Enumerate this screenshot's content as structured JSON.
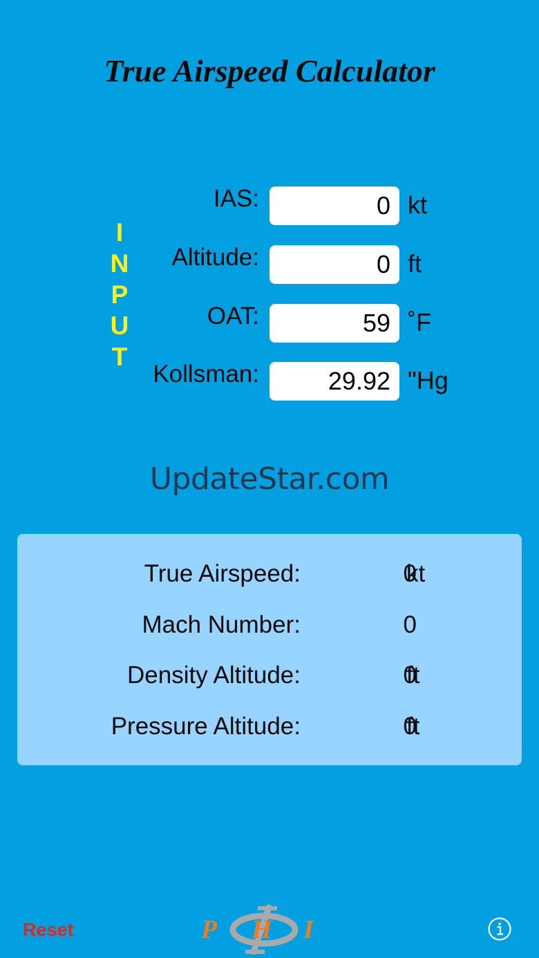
{
  "app": {
    "title": "True Airspeed Calculator"
  },
  "input_section": {
    "vertical_label": [
      "I",
      "N",
      "P",
      "U",
      "T"
    ],
    "fields": [
      {
        "label": "IAS:",
        "value": "0",
        "unit": "kt"
      },
      {
        "label": "Altitude:",
        "value": "0",
        "unit": "ft"
      },
      {
        "label": "OAT:",
        "value": "59",
        "unit": "˚F"
      },
      {
        "label": "Kollsman:",
        "value": "29.92",
        "unit": "\"Hg"
      }
    ]
  },
  "watermark": "UpdateStar.com",
  "results": [
    {
      "label": "True Airspeed:",
      "value": "0",
      "unit": "kt"
    },
    {
      "label": "Mach Number:",
      "value": "0",
      "unit": ""
    },
    {
      "label": "Density Altitude:",
      "value": "0",
      "unit": "ft"
    },
    {
      "label": "Pressure Altitude:",
      "value": "0",
      "unit": "ft"
    }
  ],
  "footer": {
    "reset_label": "Reset",
    "logo_text": "PHI",
    "info_icon": "info-icon"
  },
  "colors": {
    "background": "#02a0e0",
    "results_panel": "#97d4ff",
    "input_label": "#ffef1a",
    "reset": "#e2261c",
    "logo_orange": "#f07a1e",
    "logo_gray": "#a9a9a9"
  }
}
